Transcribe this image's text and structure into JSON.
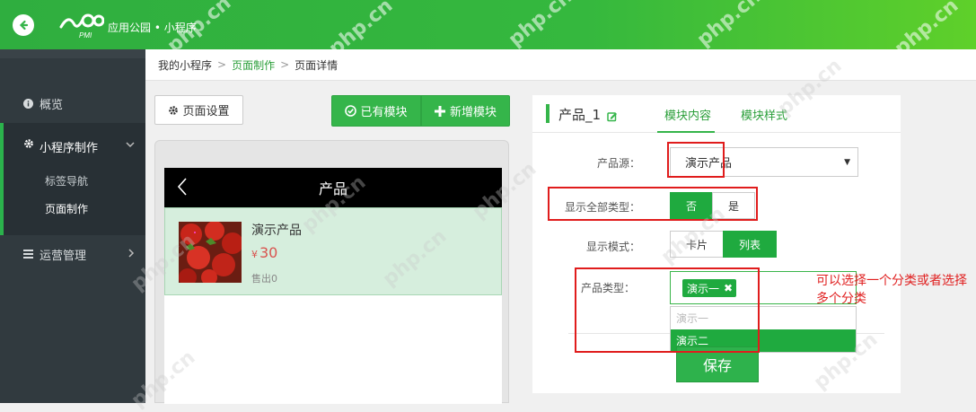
{
  "header": {
    "brand": "应用公园 • 小程序",
    "logo_text": "PMI"
  },
  "sidebar": {
    "items": [
      {
        "label": "概览",
        "icon": "info-circle-icon"
      },
      {
        "label": "小程序制作",
        "icon": "gear-icon"
      },
      {
        "label": "运营管理",
        "icon": "list-icon"
      }
    ],
    "subitems": [
      {
        "label": "标签导航"
      },
      {
        "label": "页面制作"
      }
    ]
  },
  "breadcrumb": [
    "我的小程序",
    "页面制作",
    "页面详情"
  ],
  "toolbar": {
    "page_settings": "页面设置",
    "existing_module": "已有模块",
    "new_module": "新增模块"
  },
  "preview": {
    "header_title": "产品",
    "product": {
      "name": "演示产品",
      "currency": "¥",
      "price": "30",
      "sold": "售出0"
    }
  },
  "editor": {
    "title": "产品_1",
    "tabs": [
      "模块内容",
      "模块样式"
    ],
    "fields": {
      "source_label": "产品源：",
      "source_value": "演示产品",
      "show_all_label": "显示全部类型：",
      "show_all_options": [
        "否",
        "是"
      ],
      "display_mode_label": "显示模式：",
      "display_mode_options": [
        "卡片",
        "列表"
      ],
      "category_label": "产品类型：",
      "selected_tag": "演示一",
      "dropdown_options": [
        "演示一",
        "演示二"
      ]
    },
    "save": "保存"
  },
  "annotation": "可以选择一个分类或者选择多个分类",
  "watermark": "php.cn",
  "colors": {
    "brand_green": "#35b54a",
    "sidebar_bg": "#313a3f",
    "highlight_red": "#e01c1c"
  }
}
